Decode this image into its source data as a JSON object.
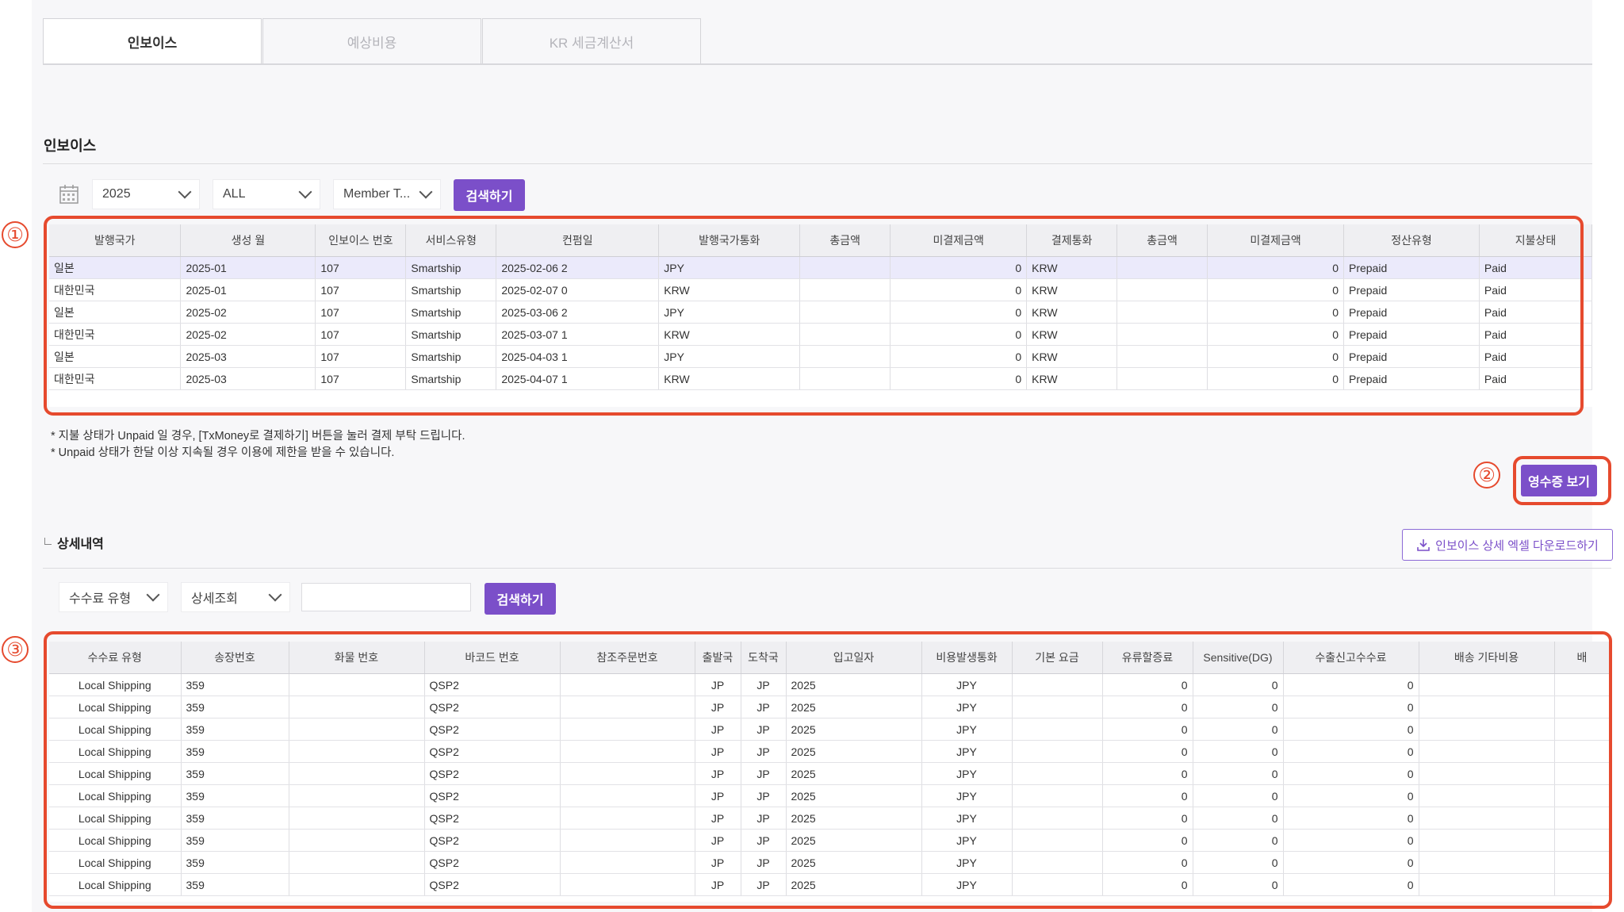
{
  "tabs": [
    {
      "label": "인보이스",
      "active": true
    },
    {
      "label": "예상비용",
      "active": false
    },
    {
      "label": "KR 세금계산서",
      "active": false
    }
  ],
  "invoice": {
    "title": "인보이스",
    "filters": {
      "year": "2025",
      "type": "ALL",
      "member": "Member T...",
      "search_label": "검색하기"
    },
    "columns": [
      "발행국가",
      "생성 월",
      "인보이스 번호",
      "서비스유형",
      "컨펌일",
      "발행국가통화",
      "총금액",
      "미결제금액",
      "결제통화",
      "총금액",
      "미결제금액",
      "정산유형",
      "지불상태"
    ],
    "rows": [
      [
        "일본",
        "2025-01",
        "107",
        "Smartship",
        "2025-02-06 2",
        "JPY",
        "",
        "0",
        "KRW",
        "",
        "0",
        "Prepaid",
        "Paid"
      ],
      [
        "대한민국",
        "2025-01",
        "107",
        "Smartship",
        "2025-02-07 0",
        "KRW",
        "",
        "0",
        "KRW",
        "",
        "0",
        "Prepaid",
        "Paid"
      ],
      [
        "일본",
        "2025-02",
        "107",
        "Smartship",
        "2025-03-06 2",
        "JPY",
        "",
        "0",
        "KRW",
        "",
        "0",
        "Prepaid",
        "Paid"
      ],
      [
        "대한민국",
        "2025-02",
        "107",
        "Smartship",
        "2025-03-07 1",
        "KRW",
        "",
        "0",
        "KRW",
        "",
        "0",
        "Prepaid",
        "Paid"
      ],
      [
        "일본",
        "2025-03",
        "107",
        "Smartship",
        "2025-04-03 1",
        "JPY",
        "",
        "0",
        "KRW",
        "",
        "0",
        "Prepaid",
        "Paid"
      ],
      [
        "대한민국",
        "2025-03",
        "107",
        "Smartship",
        "2025-04-07 1",
        "KRW",
        "",
        "0",
        "KRW",
        "",
        "0",
        "Prepaid",
        "Paid"
      ]
    ],
    "notes": [
      "* 지불 상태가 Unpaid 일 경우, [TxMoney로 결제하기] 버튼을 눌러 결제 부탁 드립니다.",
      "* Unpaid 상태가 한달 이상 지속될 경우 이용에 제한을 받을 수 있습니다."
    ],
    "receipt_label": "영수증 보기"
  },
  "detail": {
    "title": "상세내역",
    "download_label": "인보이스 상세 엑셀 다운로드하기",
    "filters": {
      "fee_type": "수수료 유형",
      "detail": "상세조회",
      "search_label": "검색하기",
      "query": ""
    },
    "columns": [
      "수수료 유형",
      "송장번호",
      "화물 번호",
      "바코드 번호",
      "참조주문번호",
      "출발국",
      "도착국",
      "입고일자",
      "비용발생통화",
      "기본 요금",
      "유류할증료",
      "Sensitive(DG)",
      "수출신고수수료",
      "배송 기타비용",
      "배"
    ],
    "rows": [
      [
        "Local Shipping",
        "359",
        "",
        "QSP2",
        "",
        "JP",
        "JP",
        "2025",
        "JPY",
        "",
        "0",
        "0",
        "0",
        "",
        ""
      ],
      [
        "Local Shipping",
        "359",
        "",
        "QSP2",
        "",
        "JP",
        "JP",
        "2025",
        "JPY",
        "",
        "0",
        "0",
        "0",
        "",
        ""
      ],
      [
        "Local Shipping",
        "359",
        "",
        "QSP2",
        "",
        "JP",
        "JP",
        "2025",
        "JPY",
        "",
        "0",
        "0",
        "0",
        "",
        ""
      ],
      [
        "Local Shipping",
        "359",
        "",
        "QSP2",
        "",
        "JP",
        "JP",
        "2025",
        "JPY",
        "",
        "0",
        "0",
        "0",
        "",
        ""
      ],
      [
        "Local Shipping",
        "359",
        "",
        "QSP2",
        "",
        "JP",
        "JP",
        "2025",
        "JPY",
        "",
        "0",
        "0",
        "0",
        "",
        ""
      ],
      [
        "Local Shipping",
        "359",
        "",
        "QSP2",
        "",
        "JP",
        "JP",
        "2025",
        "JPY",
        "",
        "0",
        "0",
        "0",
        "",
        ""
      ],
      [
        "Local Shipping",
        "359",
        "",
        "QSP2",
        "",
        "JP",
        "JP",
        "2025",
        "JPY",
        "",
        "0",
        "0",
        "0",
        "",
        ""
      ],
      [
        "Local Shipping",
        "359",
        "",
        "QSP2",
        "",
        "JP",
        "JP",
        "2025",
        "JPY",
        "",
        "0",
        "0",
        "0",
        "",
        ""
      ],
      [
        "Local Shipping",
        "359",
        "",
        "QSP2",
        "",
        "JP",
        "JP",
        "2025",
        "JPY",
        "",
        "0",
        "0",
        "0",
        "",
        ""
      ],
      [
        "Local Shipping",
        "359",
        "",
        "QSP2",
        "",
        "JP",
        "JP",
        "2025",
        "JPY",
        "",
        "0",
        "0",
        "0",
        "",
        ""
      ]
    ]
  },
  "annotations": [
    "①",
    "②",
    "③"
  ],
  "colors": {
    "accent": "#7b4fc9",
    "highlight": "#e64a2e"
  }
}
